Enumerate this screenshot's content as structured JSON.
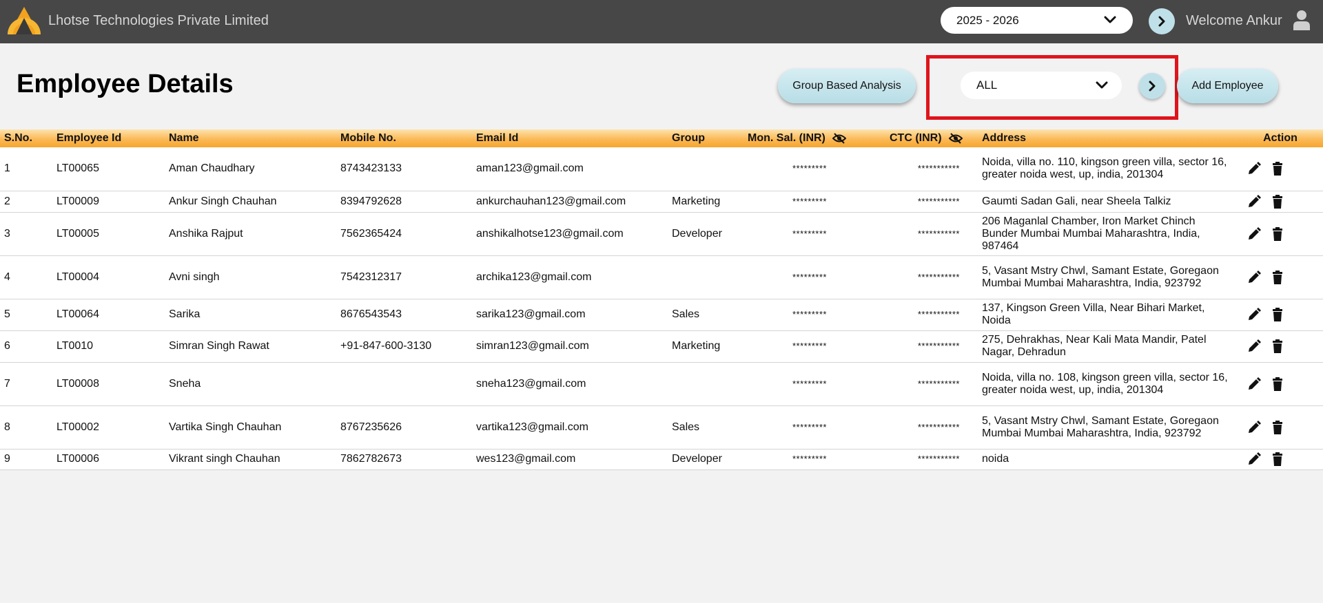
{
  "header": {
    "company_name": "Lhotse Technologies Private Limited",
    "year_select": "2025 - 2026",
    "welcome": "Welcome Ankur"
  },
  "page": {
    "title": "Employee Details",
    "group_analysis_label": "Group Based Analysis",
    "group_filter": "ALL",
    "add_employee_label": "Add Employee"
  },
  "table": {
    "columns": {
      "sno": "S.No.",
      "emp_id": "Employee Id",
      "name": "Name",
      "mobile": "Mobile No.",
      "email": "Email Id",
      "group": "Group",
      "mon_sal": "Mon. Sal. (INR)",
      "ctc": "CTC (INR)",
      "address": "Address",
      "action": "Action"
    },
    "rows": [
      {
        "sno": "1",
        "emp_id": "LT00065",
        "name": "Aman Chaudhary",
        "mobile": "8743423133",
        "email": "aman123@gmail.com",
        "group": "",
        "mon_sal": "*********",
        "ctc": "***********",
        "address": "Noida, villa no. 110, kingson green villa, sector 16, greater noida west, up, india, 201304"
      },
      {
        "sno": "2",
        "emp_id": "LT00009",
        "name": "Ankur Singh Chauhan",
        "mobile": "8394792628",
        "email": "ankurchauhan123@gmail.com",
        "group": "Marketing",
        "mon_sal": "*********",
        "ctc": "***********",
        "address": "Gaumti Sadan Gali, near Sheela Talkiz"
      },
      {
        "sno": "3",
        "emp_id": "LT00005",
        "name": "Anshika Rajput",
        "mobile": "7562365424",
        "email": "anshikalhotse123@gmail.com",
        "group": "Developer",
        "mon_sal": "*********",
        "ctc": "***********",
        "address": "206 Maganlal Chamber, Iron Market Chinch Bunder Mumbai Mumbai Maharashtra, India, 987464"
      },
      {
        "sno": "4",
        "emp_id": "LT00004",
        "name": "Avni singh",
        "mobile": "7542312317",
        "email": "archika123@gmail.com",
        "group": "",
        "mon_sal": "*********",
        "ctc": "***********",
        "address": "5, Vasant Mstry Chwl, Samant Estate, Goregaon Mumbai Mumbai Maharashtra, India, 923792"
      },
      {
        "sno": "5",
        "emp_id": "LT00064",
        "name": "Sarika",
        "mobile": "8676543543",
        "email": "sarika123@gmail.com",
        "group": "Sales",
        "mon_sal": "*********",
        "ctc": "***********",
        "address": "137, Kingson Green Villa, Near Bihari Market, Noida"
      },
      {
        "sno": "6",
        "emp_id": "LT0010",
        "name": "Simran Singh Rawat",
        "mobile": "+91-847-600-3130",
        "email": "simran123@gmail.com",
        "group": "Marketing",
        "mon_sal": "*********",
        "ctc": "***********",
        "address": "275, Dehrakhas, Near Kali Mata Mandir, Patel Nagar, Dehradun"
      },
      {
        "sno": "7",
        "emp_id": "LT00008",
        "name": "Sneha",
        "mobile": "",
        "email": "sneha123@gmail.com",
        "group": "",
        "mon_sal": "*********",
        "ctc": "***********",
        "address": "Noida, villa no. 108, kingson green villa, sector 16, greater noida west, up, india, 201304"
      },
      {
        "sno": "8",
        "emp_id": "LT00002",
        "name": "Vartika Singh Chauhan",
        "mobile": "8767235626",
        "email": "vartika123@gmail.com",
        "group": "Sales",
        "mon_sal": "*********",
        "ctc": "***********",
        "address": "5, Vasant Mstry Chwl, Samant Estate, Goregaon Mumbai Mumbai Maharashtra, India, 923792"
      },
      {
        "sno": "9",
        "emp_id": "LT00006",
        "name": "Vikrant singh Chauhan",
        "mobile": "7862782673",
        "email": "wes123@gmail.com",
        "group": "Developer",
        "mon_sal": "*********",
        "ctc": "***********",
        "address": "noida"
      }
    ]
  },
  "colors": {
    "topbar": "#474747",
    "accent_orange": "#f7a52e",
    "button_teal": "#bfe0e8",
    "highlight_red": "#e0141c"
  },
  "icons": [
    "logo-icon",
    "chevron-down-icon",
    "chevron-right-icon",
    "user-icon",
    "eye-slash-icon",
    "pencil-icon",
    "trash-icon"
  ]
}
